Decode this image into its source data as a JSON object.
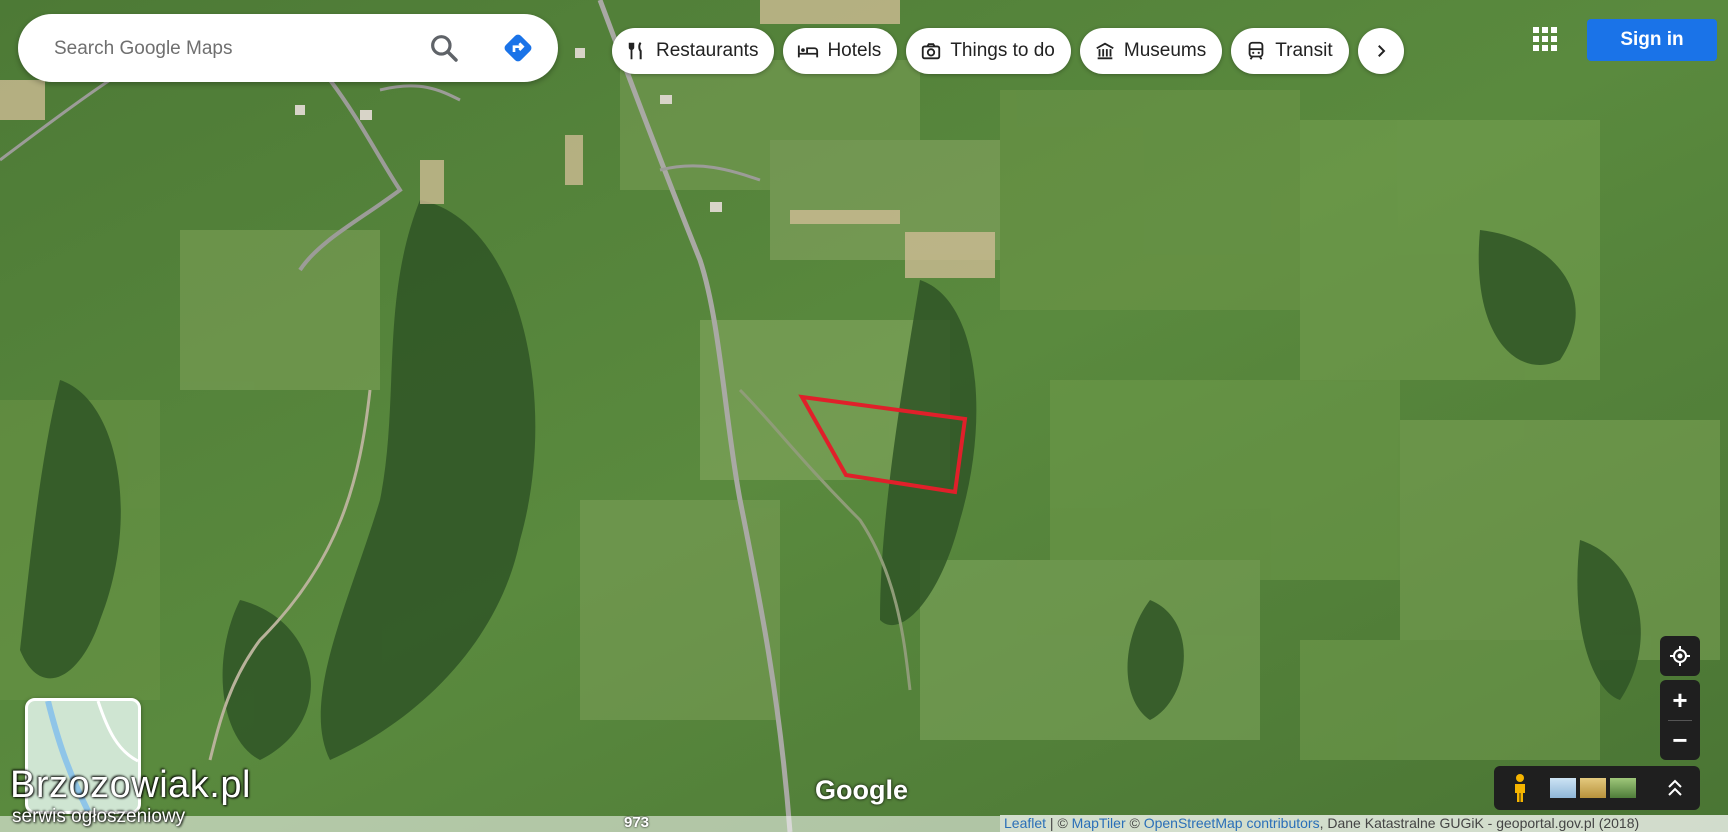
{
  "search": {
    "placeholder": "Search Google Maps"
  },
  "chips": [
    {
      "label": "Restaurants",
      "icon": "fork-knife-icon"
    },
    {
      "label": "Hotels",
      "icon": "bed-icon"
    },
    {
      "label": "Things to do",
      "icon": "camera-icon"
    },
    {
      "label": "Museums",
      "icon": "museum-icon"
    },
    {
      "label": "Transit",
      "icon": "train-icon"
    }
  ],
  "header": {
    "signin": "Sign in"
  },
  "controls": {
    "zoom_in": "+",
    "zoom_out": "−"
  },
  "map": {
    "google_logo": "Google",
    "road_number": "973",
    "parcel_color": "#e0202a",
    "attribution": {
      "leaflet": "Leaflet",
      "sep": " | © ",
      "maptiler": "MapTiler",
      "osm_prefix": " © ",
      "osm": "OpenStreetMap contributors",
      "rest": ", Dane Katastralne GUGiK - geoportal.gov.pl (2018)"
    }
  },
  "watermark": {
    "title": "Brzozowiak.pl",
    "subtitle": "serwis ogłoszeniowy"
  }
}
